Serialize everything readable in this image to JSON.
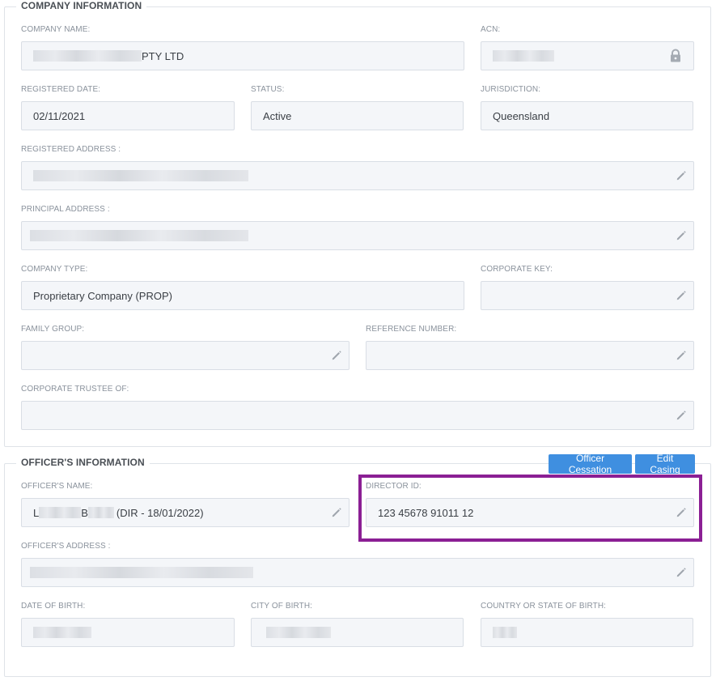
{
  "company": {
    "title": "COMPANY INFORMATION",
    "company_name_label": "COMPANY NAME:",
    "company_name_suffix": "PTY LTD",
    "acn_label": "ACN:",
    "registered_date_label": "REGISTERED DATE:",
    "registered_date": "02/11/2021",
    "status_label": "STATUS:",
    "status": "Active",
    "jurisdiction_label": "JURISDICTION:",
    "jurisdiction": "Queensland",
    "registered_address_label": "REGISTERED ADDRESS :",
    "principal_address_label": "PRINCIPAL ADDRESS :",
    "company_type_label": "COMPANY TYPE:",
    "company_type": "Proprietary Company (PROP)",
    "corporate_key_label": "CORPORATE KEY:",
    "family_group_label": "FAMILY GROUP:",
    "reference_number_label": "REFERENCE NUMBER:",
    "corporate_trustee_label": "CORPORATE TRUSTEE OF:"
  },
  "officer": {
    "title": "OFFICER'S INFORMATION",
    "cessation_button": "Officer Cessation",
    "edit_casing_button": "Edit Casing",
    "officer_name_label": "OFFICER'S NAME:",
    "officer_name_initial": "L",
    "officer_name_middle": "B",
    "officer_name_suffix": "(DIR - 18/01/2022)",
    "director_id_label": "DIRECTOR ID:",
    "director_id": "123 45678 91011 12",
    "officer_address_label": "OFFICER'S ADDRESS :",
    "dob_label": "DATE OF BIRTH:",
    "city_of_birth_label": "CITY OF BIRTH:",
    "country_of_birth_label": "COUNTRY OR STATE OF BIRTH:"
  },
  "colors": {
    "accent": "#3f8fe0",
    "highlight": "#8b1f94",
    "field_bg": "#f4f6f9"
  },
  "icons": {
    "edit": "pencil-icon",
    "lock": "lock-icon"
  }
}
